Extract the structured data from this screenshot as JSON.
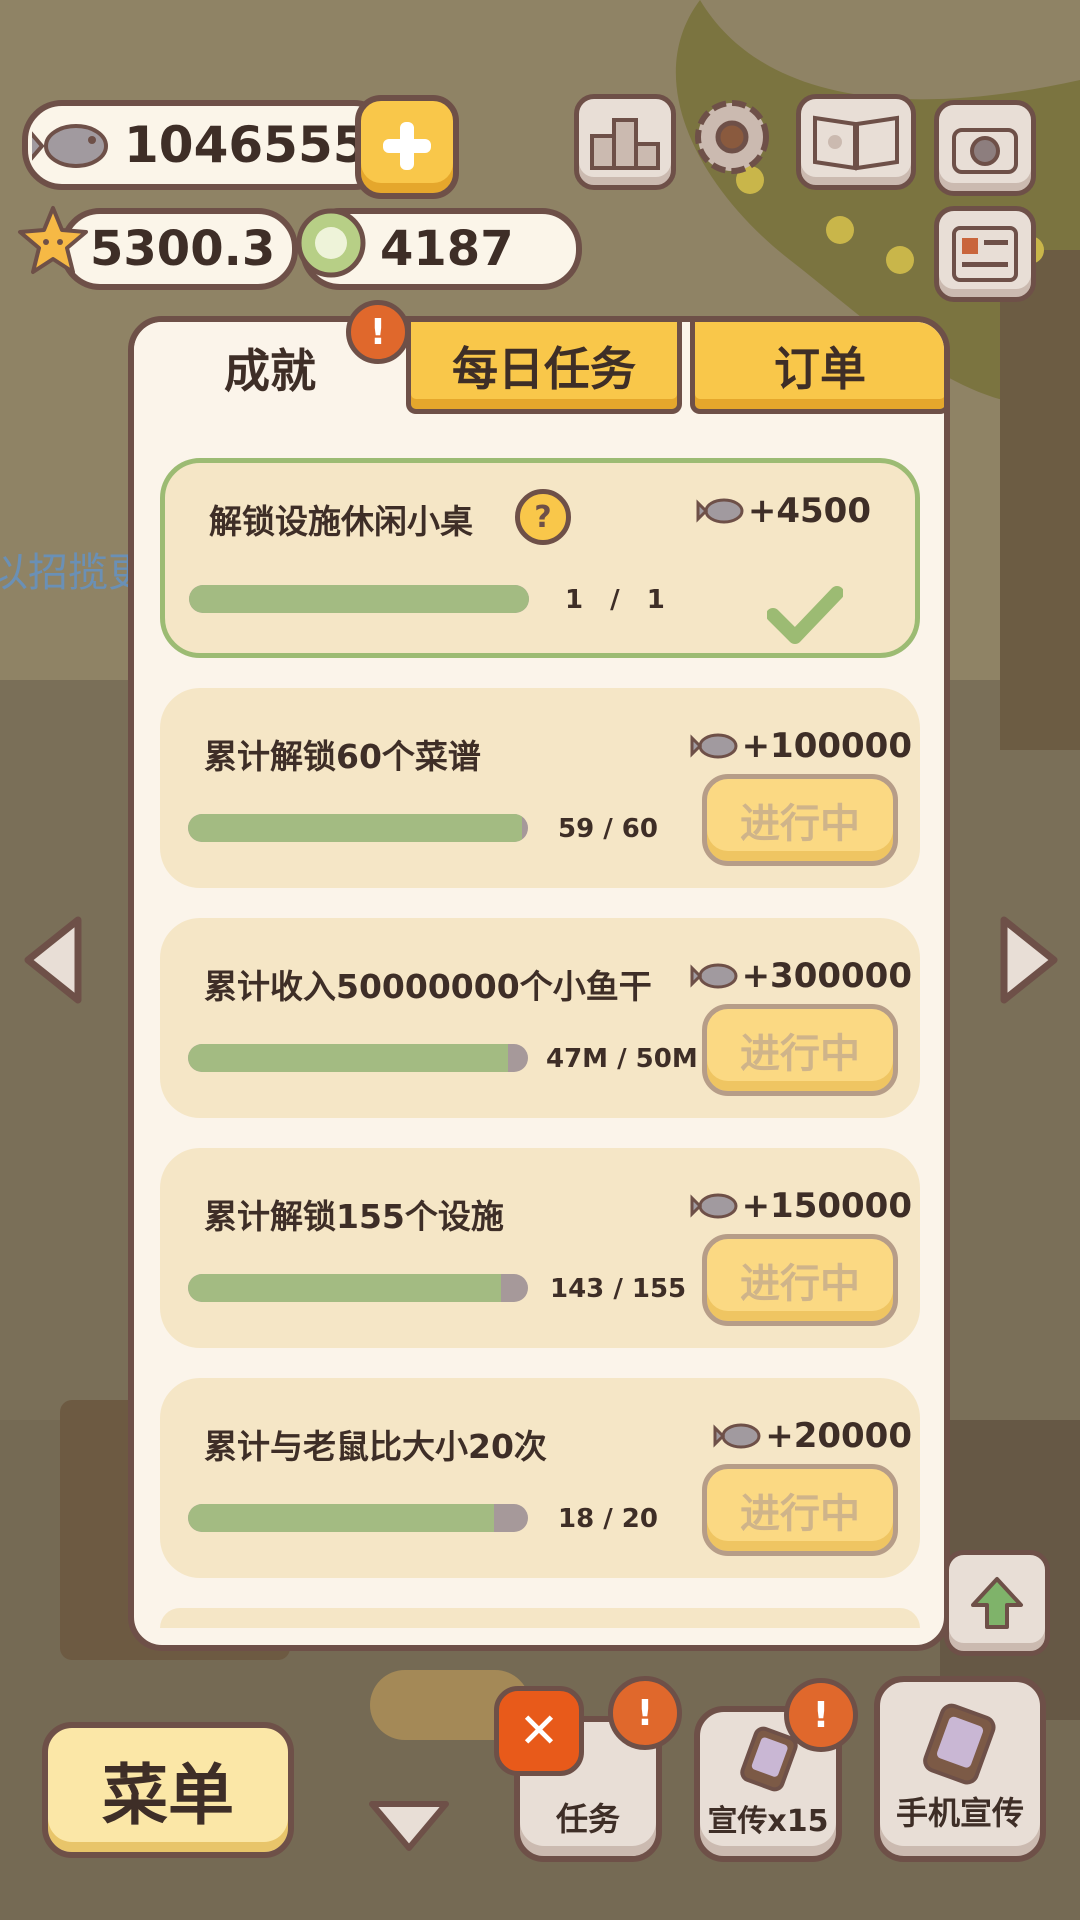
{
  "currency": {
    "fish": "1046555",
    "stars": "5300.3",
    "coins": "4187"
  },
  "tabs": {
    "achievements": "成就",
    "daily": "每日任务",
    "orders": "订单",
    "alert_mark": "!"
  },
  "background_text": "以招揽更多的顾客",
  "tasks": [
    {
      "title": "解锁设施休闲小桌",
      "reward": "+4500",
      "progress_text": "1 / 1",
      "progress": 1.0,
      "status": "completed",
      "help": "?"
    },
    {
      "title": "累计解锁60个菜谱",
      "reward": "+100000",
      "progress_text": "59 / 60",
      "progress": 0.983,
      "status": "进行中"
    },
    {
      "title": "累计收入50000000个小鱼干",
      "reward": "+300000",
      "progress_text": "47M / 50M",
      "progress": 0.94,
      "status": "进行中"
    },
    {
      "title": "累计解锁155个设施",
      "reward": "+150000",
      "progress_text": "143 / 155",
      "progress": 0.92,
      "status": "进行中"
    },
    {
      "title": "累计与老鼠比大小20次",
      "reward": "+20000",
      "progress_text": "18 / 20",
      "progress": 0.9,
      "status": "进行中"
    }
  ],
  "bottom": {
    "menu": "菜单",
    "tasks": "任务",
    "promo": "宣传x15",
    "phone_promo": "手机宣传",
    "close": "✕",
    "alert_mark": "!"
  },
  "colors": {
    "accent_yellow": "#f9c74a",
    "panel": "#fbf4ea",
    "card": "#f5e6c6",
    "progress_green": "#a3bb82",
    "outline": "#6e5048",
    "alert_orange": "#e0682c"
  }
}
